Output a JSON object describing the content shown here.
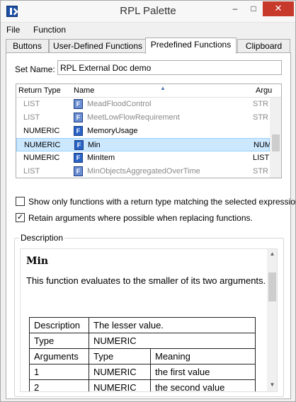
{
  "window": {
    "title": "RPL Palette",
    "minimize": "–",
    "maximize": "□",
    "close": "✕"
  },
  "menu": [
    "File",
    "Function"
  ],
  "tabs": [
    "Buttons",
    "User-Defined Functions",
    "Predefined Functions",
    "Clipboard"
  ],
  "active_tab": "Predefined Functions",
  "set_name": {
    "label": "Set Name:",
    "value": "RPL External Doc demo"
  },
  "grid": {
    "headers": {
      "return_type": "Return Type",
      "name": "Name",
      "args": "Argu"
    },
    "sort_indicator": "▲",
    "rows": [
      {
        "return_type": "LIST",
        "name": "MeadFloodControl",
        "args": "STR",
        "dim": true
      },
      {
        "return_type": "LIST",
        "name": "MeetLowFlowRequirement",
        "args": "STR",
        "dim": true
      },
      {
        "return_type": "NUMERIC",
        "name": "MemoryUsage",
        "args": "",
        "dim": false
      },
      {
        "return_type": "NUMERIC",
        "name": "Min",
        "args": "NUM",
        "dim": false,
        "selected": true
      },
      {
        "return_type": "NUMERIC",
        "name": "MinItem",
        "args": "LIST",
        "dim": false
      },
      {
        "return_type": "LIST",
        "name": "MinObjectsAggregatedOverTime",
        "args": "STR",
        "dim": true
      }
    ],
    "icon_glyph": "F"
  },
  "options": {
    "show_matching": {
      "label": "Show only functions with a return type matching the selected expression.",
      "checked": false
    },
    "retain_args": {
      "label": "Retain arguments where possible when replacing functions.",
      "checked": true
    }
  },
  "description": {
    "legend": "Description",
    "title": "Min",
    "text": "This function evaluates to the smaller of its two arguments.",
    "table": {
      "description_label": "Description",
      "description_value": "The lesser value.",
      "type_label": "Type",
      "type_value": "NUMERIC",
      "args_label": "Arguments",
      "args_type_h": "Type",
      "args_meaning_h": "Meaning",
      "args": [
        {
          "n": "1",
          "type": "NUMERIC",
          "meaning": "the first value"
        },
        {
          "n": "2",
          "type": "NUMERIC",
          "meaning": "the second value"
        }
      ]
    }
  },
  "colors": {
    "selection": "#cce8ff",
    "close_button": "#c7392b",
    "function_icon": "#2a63c6"
  }
}
